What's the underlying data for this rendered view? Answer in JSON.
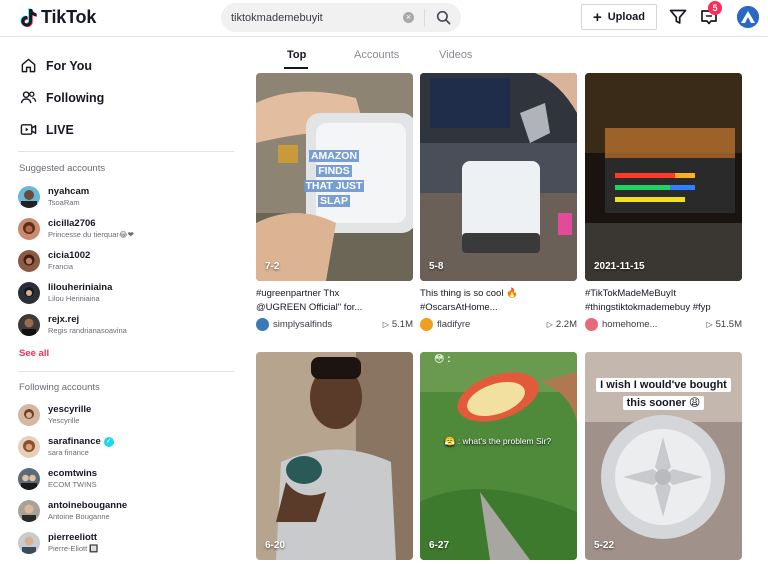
{
  "header": {
    "logo_text": "TikTok",
    "search_value": "tiktokmademebuyit",
    "upload_label": "Upload",
    "inbox_badge": "5",
    "icons": [
      "search-icon",
      "filter-icon",
      "inbox-icon"
    ]
  },
  "sidebar": {
    "nav": [
      {
        "label": "For You",
        "icon": "home-icon"
      },
      {
        "label": "Following",
        "icon": "users-icon"
      },
      {
        "label": "LIVE",
        "icon": "live-icon"
      }
    ],
    "suggested_title": "Suggested accounts",
    "suggested": [
      {
        "username": "nyahcam",
        "name": "TsoaRam"
      },
      {
        "username": "cicilla2706",
        "name": "Princesse du tierquar😂❤"
      },
      {
        "username": "cicia1002",
        "name": "Francia"
      },
      {
        "username": "lilouheriniaina",
        "name": "Lilou Heriniaina"
      },
      {
        "username": "rejx.rej",
        "name": "Regis randrianasoavina"
      }
    ],
    "see_all": "See all",
    "following_title": "Following accounts",
    "following": [
      {
        "username": "yescyrille",
        "name": "Yescyrille",
        "verified": false
      },
      {
        "username": "sarafinance",
        "name": "sara finance",
        "verified": true
      },
      {
        "username": "ecomtwins",
        "name": "ECOM TWINS",
        "verified": false
      },
      {
        "username": "antoinebouganne",
        "name": "Antoine Bouganne",
        "verified": false
      },
      {
        "username": "pierreeliott",
        "name": "Pierre-Eliott 🔲",
        "verified": false
      }
    ]
  },
  "tabs": [
    "Top",
    "Accounts",
    "Videos"
  ],
  "videos": [
    {
      "date": "7-2",
      "overlay": [
        "AMAZON",
        "FINDS",
        "THAT JUST",
        "SLAP"
      ],
      "caption_line1": "#ugreenpartner Thx",
      "caption_line2": "@UGREEN Official\" for...",
      "author": "simplysalfinds",
      "views": "5.1M"
    },
    {
      "date": "5-8",
      "caption_line1": "This thing is so cool 🔥",
      "caption_line2": "#OscarsAtHome...",
      "author": "fladifyre",
      "views": "2.2M"
    },
    {
      "date": "2021-11-15",
      "caption_line1": "#TikTokMadeMeBuyIt",
      "caption_line2": "#thingstiktokmademebuy #fyp",
      "author": "homehome...",
      "views": "51.5M"
    },
    {
      "date": "6-20"
    },
    {
      "date": "6-27",
      "overlay_top": "😳 :",
      "overlay": "😤 : what's the problem Sir?"
    },
    {
      "date": "5-22",
      "overlay": [
        "I wish I would've bought",
        "this sooner 😩"
      ]
    }
  ],
  "colors": {
    "brand_red": "#fe2c55",
    "text": "#161823",
    "verified": "#20d5ec"
  }
}
